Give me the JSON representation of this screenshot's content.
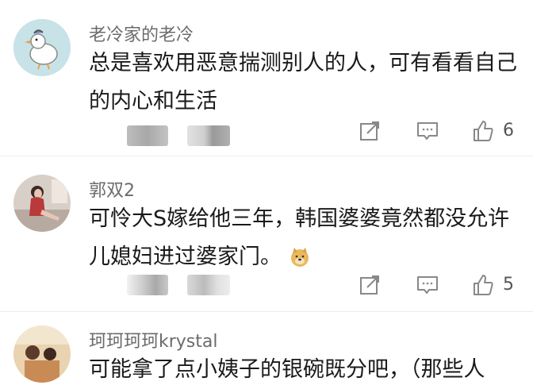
{
  "comments": [
    {
      "username": "老冷家的老冷",
      "text": "总是喜欢用恶意揣测别人的人，可有看看自己的内心和生活",
      "like_icon": "thumbs-up-icon",
      "like_count": "6"
    },
    {
      "username": "郭双2",
      "text": "可怜大S嫁给他三年，韩国婆婆竟然都没允许儿媳妇进过婆家门。",
      "emoji": "doge-emoji",
      "like_icon": "thumbs-up-icon",
      "like_count": "5"
    },
    {
      "username": "珂珂珂珂krystal",
      "text": "可能拿了点小姨子的银碗既分吧，（那些人"
    }
  ],
  "icons": {
    "share": "share-icon",
    "reply": "reply-icon",
    "like": "thumbs-up-icon"
  },
  "colors": {
    "username": "#6b6b6b",
    "text": "#1a1a1a",
    "icon": "#888888",
    "divider": "#ececec"
  }
}
